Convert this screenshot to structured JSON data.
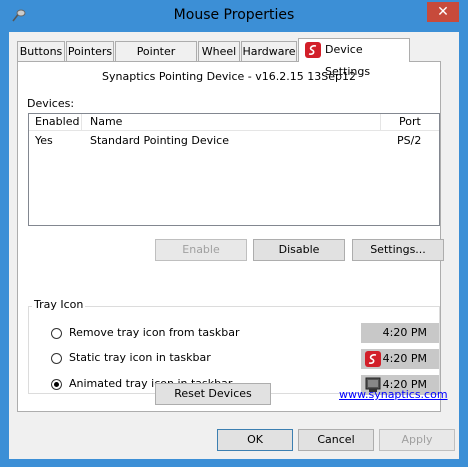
{
  "window": {
    "title": "Mouse Properties",
    "close_glyph": "✕"
  },
  "tabs": [
    {
      "label": "Buttons"
    },
    {
      "label": "Pointers"
    },
    {
      "label": "Pointer Options"
    },
    {
      "label": "Wheel"
    },
    {
      "label": "Hardware"
    },
    {
      "label": "Device Settings",
      "icon": "synaptics-logo-icon",
      "selected": true
    }
  ],
  "device_settings": {
    "device_title": "Synaptics Pointing Device - v16.2.15 13Sep12",
    "devices_label": "Devices:",
    "columns": [
      "Enabled",
      "Name",
      "Port"
    ],
    "rows": [
      {
        "enabled": "Yes",
        "name": "Standard Pointing Device",
        "port": "PS/2"
      }
    ],
    "buttons": {
      "enable": "Enable",
      "disable": "Disable",
      "settings": "Settings..."
    },
    "tray_icon": {
      "label": "Tray Icon",
      "options": [
        {
          "label": "Remove tray icon from taskbar",
          "time": "4:20 PM",
          "selected": false,
          "icon": ""
        },
        {
          "label": "Static tray icon in taskbar",
          "time": "4:20 PM",
          "selected": false,
          "icon": "synaptics-tray-icon"
        },
        {
          "label": "Animated tray icon in taskbar",
          "time": "4:20 PM",
          "selected": true,
          "icon": "touchpad-tray-icon"
        }
      ]
    },
    "reset_label": "Reset Devices",
    "link_text": "www.synaptics.com"
  },
  "dialog_buttons": {
    "ok": "OK",
    "cancel": "Cancel",
    "apply": "Apply"
  },
  "colors": {
    "title_bar": "#3c8fd6",
    "close_button": "#c74a3b",
    "synaptics_red": "#d21f29",
    "link": "#0000ff"
  }
}
